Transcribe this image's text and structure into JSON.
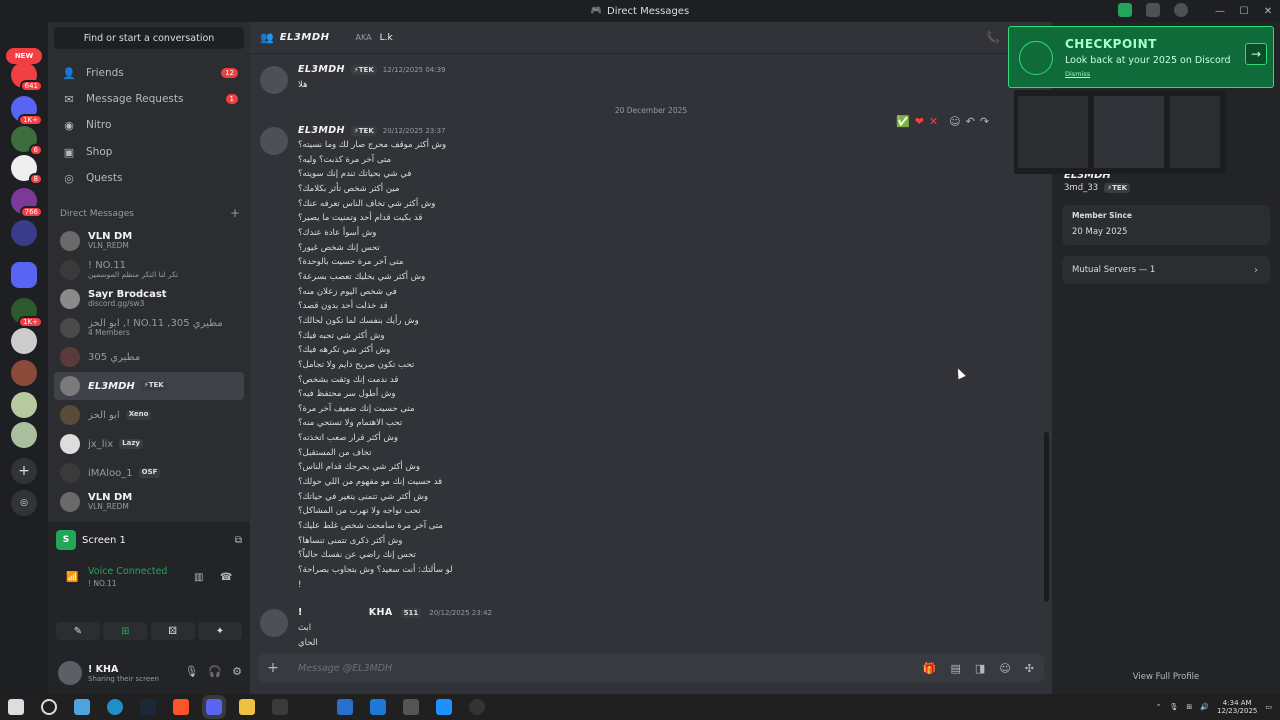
{
  "window": {
    "title": "Direct Messages",
    "minimize": "—",
    "maximize": "☐",
    "close": "✕"
  },
  "guild_bar": {
    "new_label": "NEW",
    "badges": [
      "641",
      "1K+",
      "6",
      "8",
      "766",
      "1K+"
    ]
  },
  "sidebar": {
    "search_label": "Find or start a conversation",
    "nav": [
      {
        "label": "Friends",
        "icon": "friends-icon",
        "badge": "12"
      },
      {
        "label": "Message Requests",
        "icon": "mail-icon",
        "badge": "1"
      },
      {
        "label": "Nitro",
        "icon": "nitro-icon",
        "badge": ""
      },
      {
        "label": "Shop",
        "icon": "shop-icon",
        "badge": ""
      },
      {
        "label": "Quests",
        "icon": "quests-icon",
        "badge": ""
      }
    ],
    "dm_header": "Direct Messages",
    "dm_add": "+",
    "dms": [
      {
        "name": "VLN DM",
        "sub": "VLN_REDM",
        "dim": false
      },
      {
        "name": "! NO.11",
        "sub": "تكر لنا التكر منظم الموسمين",
        "dim": true
      },
      {
        "name": "Sayr Brodcast",
        "sub": "discord.gg/sw3",
        "dim": false
      },
      {
        "name": "ابو الحز ,! NO.11 ,305 مطيري",
        "sub": "4 Members",
        "dim": true
      },
      {
        "name": "305 مطيري",
        "sub": "",
        "dim": true
      },
      {
        "name": "EL3MDH",
        "sub": "",
        "dim": false,
        "tag": "⚡TEK"
      },
      {
        "name": "ابو الحز",
        "sub": "",
        "dim": true,
        "tag": "Xeno"
      },
      {
        "name": "jx_lix",
        "sub": "",
        "dim": true,
        "tag": "Lazy"
      },
      {
        "name": "iMAloo_1",
        "sub": "",
        "dim": true,
        "tag": "OSF"
      },
      {
        "name": "VLN DM",
        "sub": "VLN_REDM",
        "dim": false
      }
    ]
  },
  "voice": {
    "screen_label": "Screen 1",
    "screen_icon_text": "S",
    "status": "Voice Connected",
    "channel": "! NO.11",
    "buttons": [
      "✎",
      "⊞",
      "⚄",
      "✦"
    ]
  },
  "user": {
    "name": "! KHA",
    "status": "Sharing their screen"
  },
  "chat": {
    "header_name": "EL3MDH",
    "aka_label": "AKA",
    "aka_value": "L.k",
    "date_divider": "20 December 2025",
    "messages": [
      {
        "author": "EL3MDH",
        "tag": "⚡TEK",
        "time": "12/12/2025 04:39",
        "lines": [
          "هلا"
        ]
      },
      {
        "author": "EL3MDH",
        "tag": "⚡TEK",
        "time": "20/12/2025 23:37",
        "lines": [
          "وش أكثر موقف محرج صار لك وما نسيته؟",
          "متى آخر مرة كذبت؟ وليه؟",
          "في شي بحياتك تندم إنك سويته؟",
          "مين أكثر شخص تأثر بكلامك؟",
          "وش أكثر شي تخاف الناس تعرفه عنك؟",
          "قد بكيت قدام أحد وتمنيت ما يصير؟",
          "وش أسوأ عادة عندك؟",
          "تحس إنك شخص غيور؟",
          "متى آخر مرة حسيت بالوحدة؟",
          "وش أكثر شي يخليك تعصب بسرعة؟",
          "في شخص اليوم زعلان منه؟",
          "قد خذلت أحد بدون قصد؟",
          "وش رأيك بنفسك لما تكون لحالك؟",
          "وش أكثر شي تحبه فيك؟",
          "وش أكثر شي تكرهه فيك؟",
          "تحب تكون صريح دايم ولا تجامل؟",
          "قد ندمت إنك وثقت بشخص؟",
          "وش أطول سر محتفظ فيه؟",
          "متى حسيت إنك ضعيف آخر مرة؟",
          "تحب الاهتمام ولا تستحي منه؟",
          "وش أكثر قرار صعب اتخذته؟",
          "تخاف من المستقبل؟",
          "وش أكثر شي يحرجك قدام الناس؟",
          "قد حسيت إنك مو مفهوم من اللي حولك؟",
          "وش أكثر شي تتمنى يتغير في حياتك؟",
          "تحب تواجه ولا تهرب من المشاكل؟",
          "متى آخر مرة سامحت شخص غلط عليك؟",
          "وش أكثر ذكرى تتمنى تنساها؟",
          "تحس إنك راضي عن نفسك حالياً؟",
          "لو سألتك: أنت سعيد؟ وش بتجاوب بصراحة؟",
          "!"
        ]
      },
      {
        "author": "KHA",
        "prefix": "!",
        "tag": "511",
        "time": "20/12/2025 23:42",
        "lines": [
          "ابث",
          "الحاي"
        ]
      }
    ],
    "reactions": [
      "✅",
      "❤",
      "✕"
    ],
    "composer_placeholder": "Message @EL3MDH",
    "composer_plus": "+"
  },
  "profile_panel": {
    "username": "EL3MDH",
    "handle": "3md_33",
    "tag": "⚡TEK",
    "member_since_label": "Member Since",
    "member_since": "20 May 2025",
    "mutual_servers": "Mutual Servers — 1",
    "view_full": "View Full Profile"
  },
  "checkpoint": {
    "title": "CHECKPOINT",
    "subtitle": "Look back at your 2025 on Discord",
    "dismiss": "Dismiss",
    "arrow": "→"
  },
  "taskbar": {
    "time": "4:34 AM",
    "date": "12/23/2025"
  },
  "colors": {
    "accent_green": "#23a55a",
    "badge_red": "#f23f43",
    "checkpoint_green": "#0f6b3a"
  }
}
